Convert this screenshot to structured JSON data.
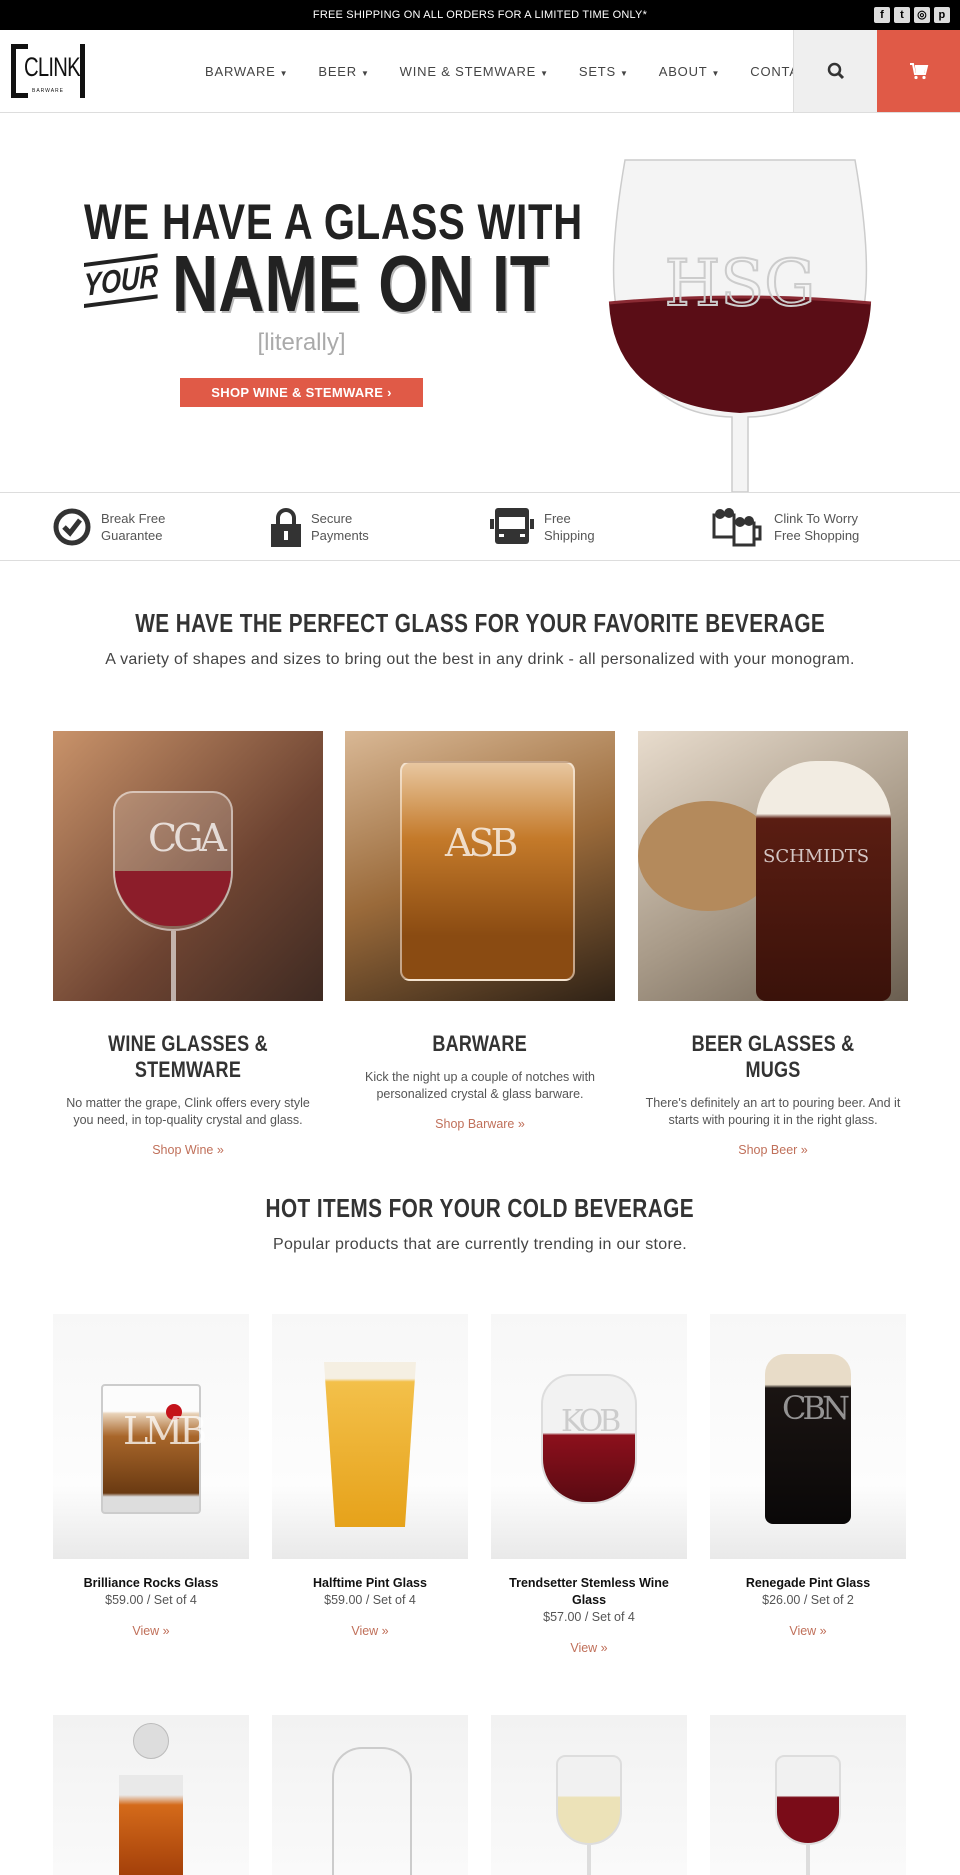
{
  "topbar": {
    "announcement": "FREE SHIPPING ON ALL ORDERS FOR A LIMITED TIME ONLY*",
    "social": [
      {
        "icon": "facebook-icon",
        "glyph": "f"
      },
      {
        "icon": "twitter-icon",
        "glyph": "t"
      },
      {
        "icon": "instagram-icon",
        "glyph": "◎"
      },
      {
        "icon": "pinterest-icon",
        "glyph": "p"
      }
    ]
  },
  "header": {
    "logo_text": "CLINK",
    "logo_sub": "BARWARE",
    "nav": [
      {
        "label": "BARWARE",
        "dropdown": true
      },
      {
        "label": "BEER",
        "dropdown": true
      },
      {
        "label": "WINE & STEMWARE",
        "dropdown": true
      },
      {
        "label": "SETS",
        "dropdown": true
      },
      {
        "label": "ABOUT",
        "dropdown": true
      },
      {
        "label": "CONTACT",
        "dropdown": false
      }
    ],
    "caret": "▼",
    "search_icon": "search-icon",
    "cart_icon": "cart-icon",
    "accent": "#e05a47"
  },
  "hero": {
    "line1": "WE HAVE A GLASS WITH",
    "your": "YOUR",
    "line2": "NAME ON IT",
    "literally": "[literally]",
    "button": "SHOP WINE & STEMWARE ›",
    "monogram": "HSG"
  },
  "features": [
    {
      "icon": "check-circle-icon",
      "l1": "Break Free",
      "l2": "Guarantee"
    },
    {
      "icon": "lock-icon",
      "l1": "Secure",
      "l2": "Payments"
    },
    {
      "icon": "truck-icon",
      "l1": "Free",
      "l2": "Shipping"
    },
    {
      "icon": "beer-mugs-icon",
      "l1": "Clink To Worry",
      "l2": "Free Shopping"
    }
  ],
  "categories_section": {
    "title": "WE HAVE THE PERFECT GLASS FOR YOUR FAVORITE BEVERAGE",
    "subtitle": "A variety of shapes and sizes to bring out the best in any drink - all personalized with your monogram."
  },
  "categories": [
    {
      "title": "WINE GLASSES & STEMWARE",
      "desc": "No matter the grape, Clink offers every style you need, in top-quality crystal and glass.",
      "link": "Shop Wine »",
      "monogram": "CGA"
    },
    {
      "title": "BARWARE",
      "desc": "Kick the night up a couple of notches with personalized crystal & glass barware.",
      "link": "Shop Barware »",
      "monogram": "ASB"
    },
    {
      "title": "BEER GLASSES & MUGS",
      "desc": "There's definitely an art to pouring beer. And it starts with pouring it in the right glass.",
      "link": "Shop Beer »",
      "monogram": "SCHMIDTS"
    }
  ],
  "hot_section": {
    "title": "HOT ITEMS FOR YOUR COLD BEVERAGE",
    "subtitle": "Popular products that are currently trending in our store."
  },
  "products": [
    {
      "name": "Brilliance Rocks Glass",
      "price": "$59.00 / Set of 4",
      "link": "View »",
      "monogram": "LMB"
    },
    {
      "name": "Halftime Pint Glass",
      "price": "$59.00 / Set of 4",
      "link": "View »"
    },
    {
      "name": "Trendsetter Stemless Wine Glass",
      "price": "$57.00 / Set of 4",
      "link": "View »",
      "monogram": "KOB"
    },
    {
      "name": "Renegade Pint Glass",
      "price": "$26.00 / Set of 2",
      "link": "View »",
      "monogram": "CBN"
    }
  ]
}
